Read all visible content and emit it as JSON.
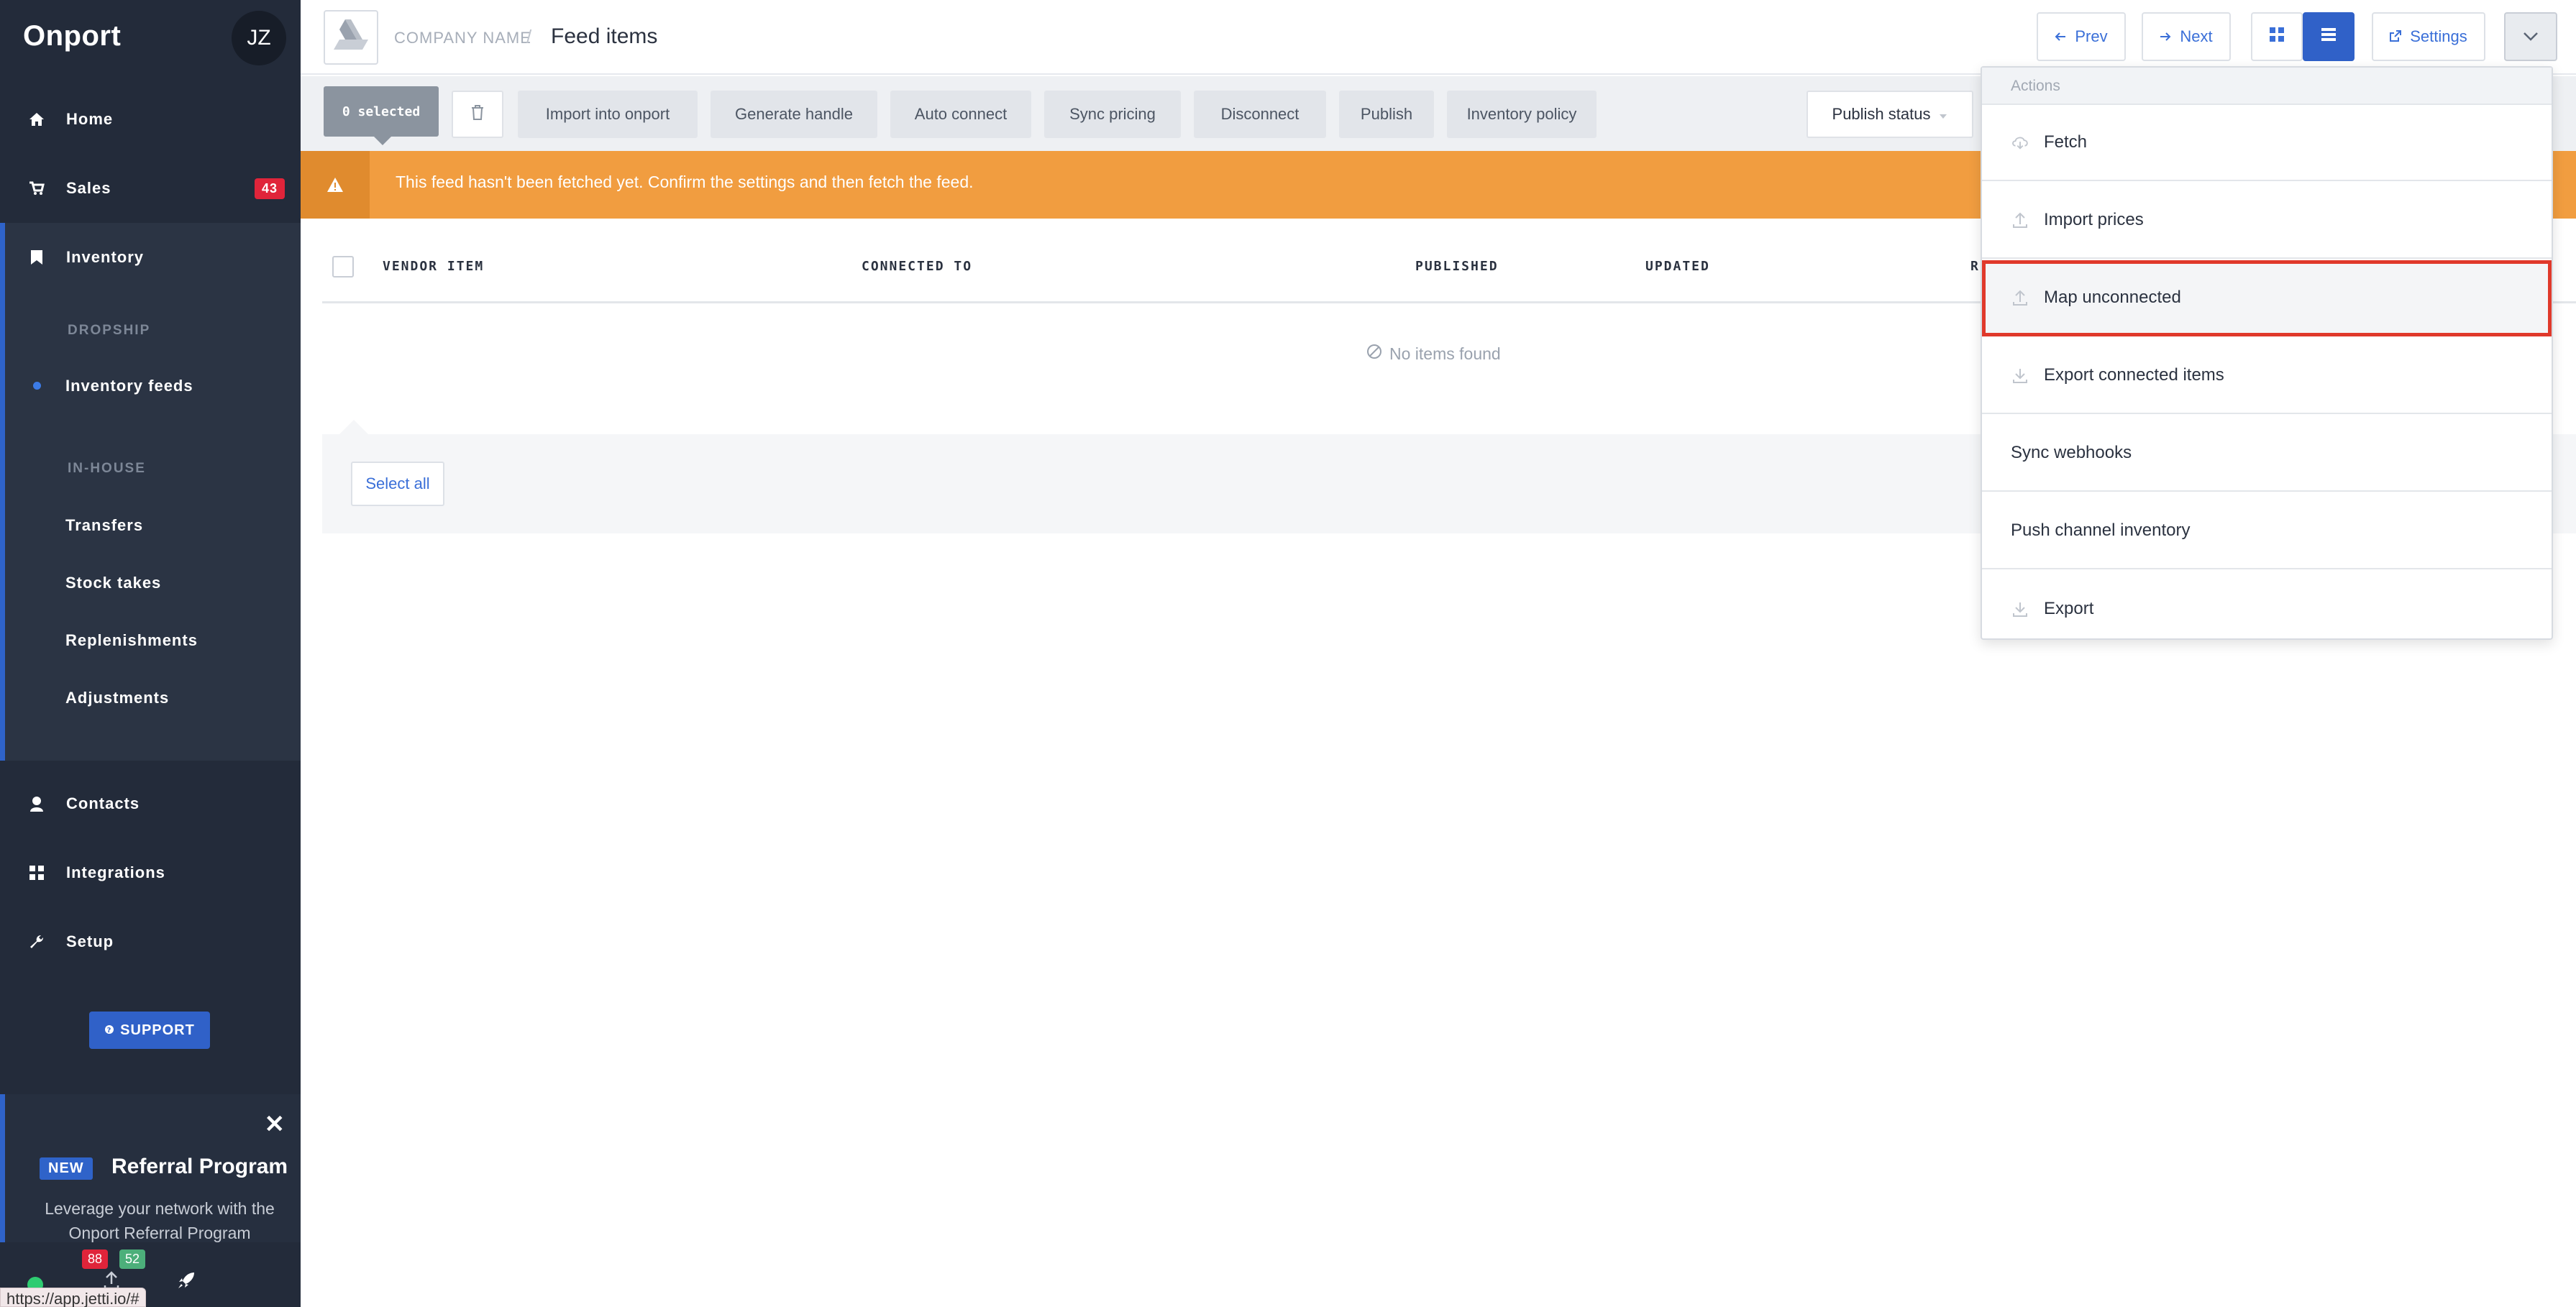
{
  "app": {
    "brand": "Onport",
    "avatar_initials": "JZ"
  },
  "sidebar": {
    "items": [
      {
        "label": "Home",
        "icon": "home-icon"
      },
      {
        "label": "Sales",
        "icon": "cart-icon",
        "badge": "43"
      },
      {
        "label": "Inventory",
        "icon": "bookmark-icon"
      },
      {
        "label": "Contacts",
        "icon": "user-icon"
      },
      {
        "label": "Integrations",
        "icon": "grid-icon"
      },
      {
        "label": "Setup",
        "icon": "wrench-icon"
      }
    ],
    "inventory_sub": {
      "dropship_heading": "DROPSHIP",
      "dropship_items": [
        "Inventory feeds"
      ],
      "inhouse_heading": "IN-HOUSE",
      "inhouse_items": [
        "Transfers",
        "Stock takes",
        "Replenishments",
        "Adjustments"
      ]
    },
    "support_label": "SUPPORT",
    "referral": {
      "new_badge": "NEW",
      "title": "Referral Program",
      "text": "Leverage your network with the Onport Referral Program"
    },
    "bottom_badges": {
      "red": "88",
      "green": "52"
    },
    "url_tooltip": "https://app.jetti.io/#"
  },
  "header": {
    "company": "COMPANY NAME",
    "separator": "/",
    "title": "Feed items",
    "prev_label": "Prev",
    "next_label": "Next",
    "settings_label": "Settings"
  },
  "toolbar": {
    "selected_label": "0 selected",
    "actions": [
      "Import into onport",
      "Generate handle",
      "Auto connect",
      "Sync pricing",
      "Disconnect",
      "Publish",
      "Inventory policy"
    ],
    "publish_status_label": "Publish status"
  },
  "alert": {
    "text": "This feed hasn't been fetched yet. Confirm the settings and then fetch the feed."
  },
  "table": {
    "columns": [
      "VENDOR ITEM",
      "CONNECTED TO",
      "PUBLISHED",
      "UPDATED",
      "R"
    ],
    "empty_text": "No items found",
    "select_all_label": "Select all"
  },
  "menu": {
    "heading": "Actions",
    "items": [
      {
        "label": "Fetch",
        "icon": "cloud-download-icon"
      },
      {
        "label": "Import prices",
        "icon": "upload-icon"
      },
      {
        "label": "Map unconnected",
        "icon": "upload-icon"
      },
      {
        "label": "Export connected items",
        "icon": "download-icon"
      },
      {
        "label": "Sync webhooks",
        "icon": ""
      },
      {
        "label": "Push channel inventory",
        "icon": ""
      },
      {
        "label": "Export",
        "icon": "download-icon"
      }
    ]
  },
  "colors": {
    "sidebar_bg": "#232b3a",
    "accent": "#3061c8",
    "alert": "#f19d40",
    "badge_red": "#e0243a",
    "highlight_outline": "#e0392b"
  }
}
